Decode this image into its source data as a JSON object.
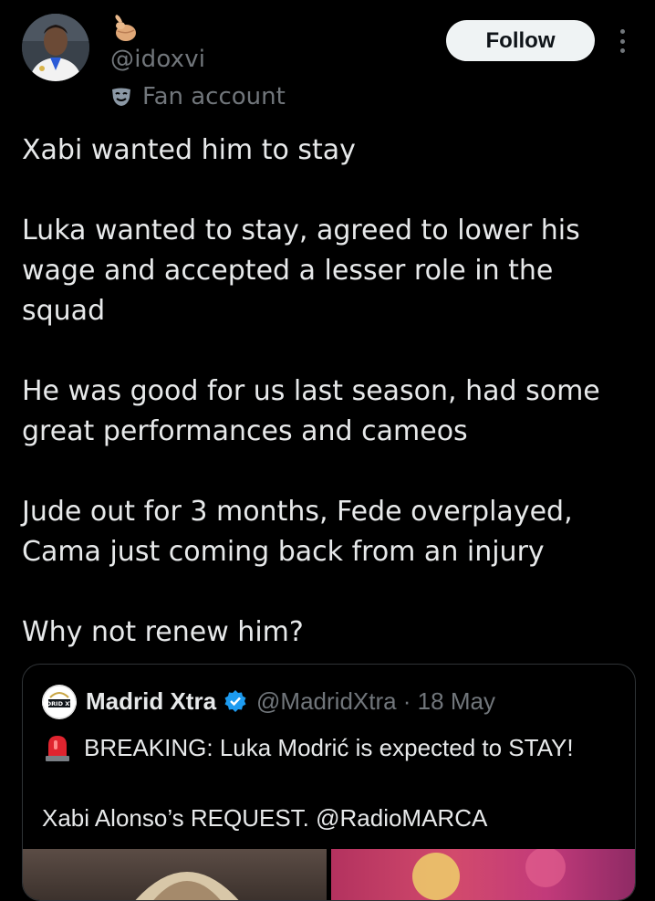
{
  "author": {
    "handle": "@idoxvi",
    "badge_label": "Fan account",
    "avatar_icon": "avatar-photo",
    "name_emoji_icon": "pointing-hand-emoji-icon",
    "badge_icon": "mask-icon"
  },
  "actions": {
    "follow_label": "Follow",
    "more_icon": "more-vertical-icon"
  },
  "tweet": {
    "lines": [
      "Xabi wanted him to stay",
      "Luka wanted to stay, agreed to lower his",
      "wage and accepted a lesser role in the",
      "squad",
      "He was good for us last season, had some",
      "great performances and cameos",
      "Jude out for 3 months, Fede overplayed,",
      "Cama just coming back from an injury",
      "Why not renew him?"
    ]
  },
  "quote": {
    "name": "Madrid Xtra",
    "handle_date": "@MadridXtra · 18 May",
    "line1": "BREAKING: Luka Modrić is expected to STAY!",
    "line2": "Xabi Alonso’s REQUEST. @RadioMARCA",
    "logo_text": "MADRID XTRA",
    "verified_color": "#1d9bf0",
    "siren_icon": "siren-emoji-icon"
  },
  "colors": {
    "background": "#000000",
    "text": "#e7e9ea",
    "muted": "#71767b",
    "border": "#2f3336",
    "button_bg": "#eff3f4"
  }
}
